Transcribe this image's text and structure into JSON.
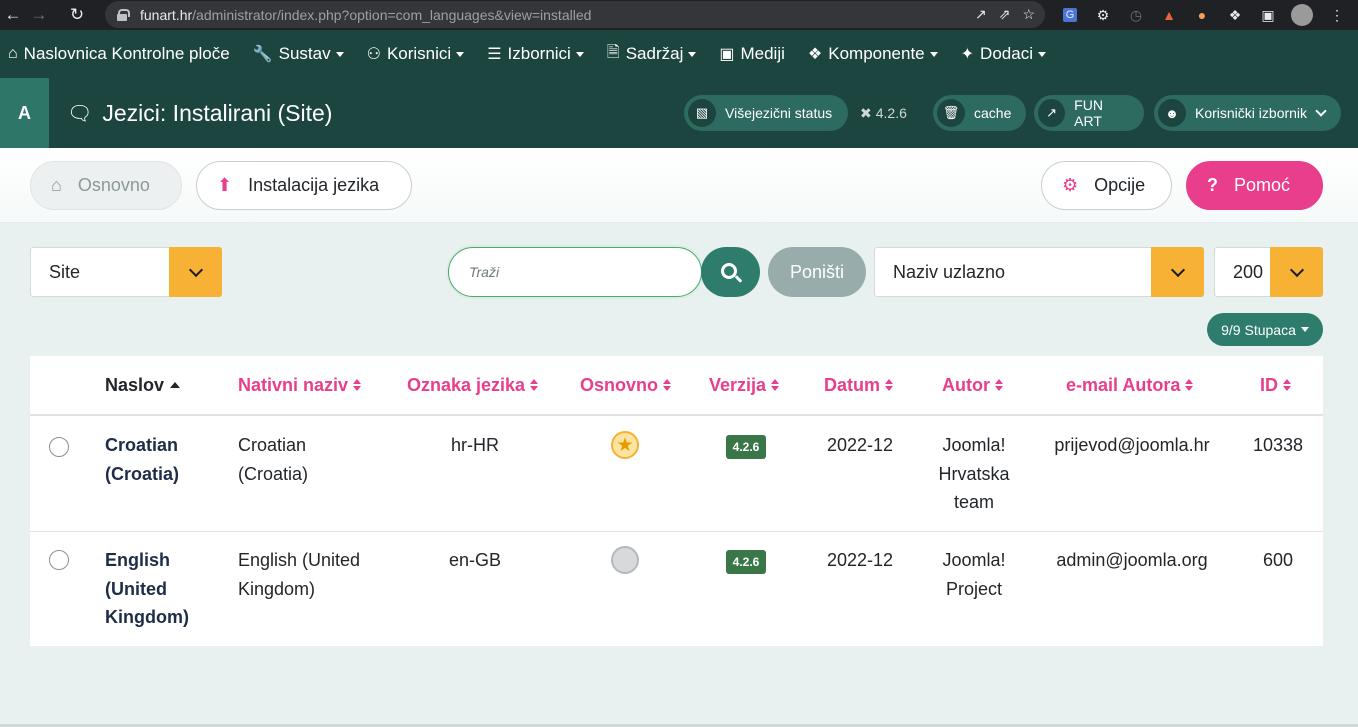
{
  "browser": {
    "url_host": "funart.hr",
    "url_path": "/administrator/index.php?option=com_languages&view=installed"
  },
  "topmenu": {
    "items": [
      {
        "label": "Naslovnica Kontrolne ploče",
        "icon": "home-icon",
        "has_caret": false
      },
      {
        "label": "Sustav",
        "icon": "wrench-icon",
        "has_caret": true
      },
      {
        "label": "Korisnici",
        "icon": "users-icon",
        "has_caret": true
      },
      {
        "label": "Izbornici",
        "icon": "list-icon",
        "has_caret": true
      },
      {
        "label": "Sadržaj",
        "icon": "file-icon",
        "has_caret": true
      },
      {
        "label": "Mediji",
        "icon": "image-icon",
        "has_caret": false
      },
      {
        "label": "Komponente",
        "icon": "puzzle-icon",
        "has_caret": true
      },
      {
        "label": "Dodaci",
        "icon": "cubes-icon",
        "has_caret": true
      }
    ]
  },
  "header": {
    "title": "Jezici: Instalirani (Site)",
    "multilang_status": "Višejezični status",
    "version": "4.2.6",
    "cache": "cache",
    "site_link": "FUN ART",
    "user_menu": "Korisnički izbornik"
  },
  "toolbar": {
    "osnovno": "Osnovno",
    "instalacija": "Instalacija jezika",
    "opcije": "Opcije",
    "pomoc": "Pomoć"
  },
  "filters": {
    "client_value": "Site",
    "search_placeholder": "Traži",
    "reset_label": "Poništi",
    "sort_value": "Naziv uzlazno",
    "limit_value": "200",
    "columns_label": "9/9 Stupaca"
  },
  "table": {
    "headers": {
      "naslov": "Naslov",
      "nativni": "Nativni naziv",
      "oznaka": "Oznaka jezika",
      "osnovno": "Osnovno",
      "verzija": "Verzija",
      "datum": "Datum",
      "autor": "Autor",
      "email": "e-mail Autora",
      "id": "ID"
    },
    "rows": [
      {
        "naslov_1": "Croatian",
        "naslov_2": "(Croatia)",
        "nativni_1": "Croatian",
        "nativni_2": "(Croatia)",
        "oznaka": "hr-HR",
        "is_default": true,
        "verzija": "4.2.6",
        "datum": "2022-12",
        "autor_1": "Joomla!",
        "autor_2": "Hrvatska",
        "autor_3": "team",
        "email": "prijevod@joomla.hr",
        "id": "10338"
      },
      {
        "naslov_1": "English",
        "naslov_2": "(United",
        "naslov_3": "Kingdom)",
        "nativni_1": "English (United",
        "nativni_2": "Kingdom)",
        "oznaka": "en-GB",
        "is_default": false,
        "verzija": "4.2.6",
        "datum": "2022-12",
        "autor_1": "Joomla!",
        "autor_2": "Project",
        "email": "admin@joomla.org",
        "id": "600"
      }
    ]
  },
  "colors": {
    "header_bg": "#1d4540",
    "accent_pink": "#e83e8c",
    "accent_green": "#2e7d6c",
    "dropdown_orange": "#f7b134"
  }
}
